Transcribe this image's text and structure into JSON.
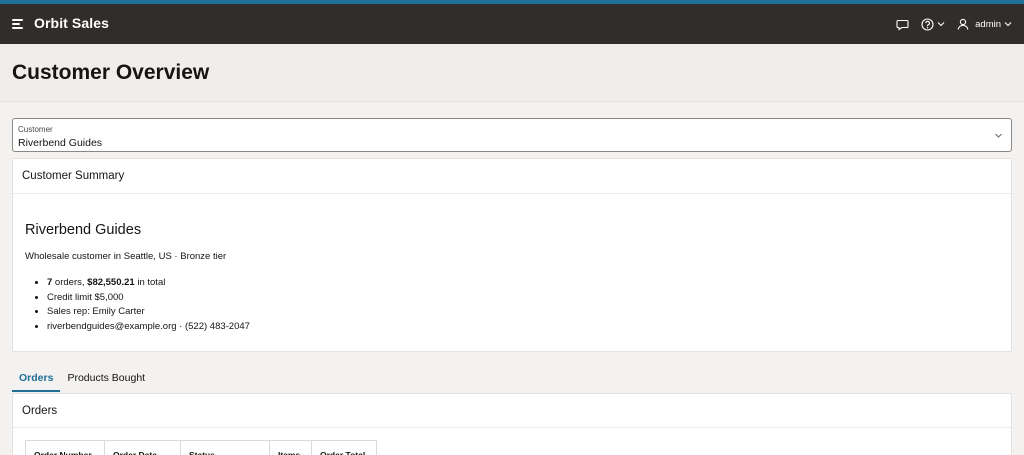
{
  "header": {
    "app_title": "Orbit Sales",
    "user_name": "admin"
  },
  "page": {
    "title": "Customer Overview"
  },
  "customer_select": {
    "label": "Customer",
    "value": "Riverbend Guides"
  },
  "summary": {
    "heading": "Customer Summary",
    "name": "Riverbend Guides",
    "description": "Wholesale customer in Seattle, US · Bronze tier",
    "orders_count": "7",
    "orders_text": " orders, ",
    "orders_total": "$82,550.21",
    "total_suffix": " in total",
    "credit_limit": "Credit limit $5,000",
    "sales_rep": "Sales rep: Emily Carter",
    "contact": "riverbendguides@example.org · (522) 483-2047"
  },
  "tabs": [
    {
      "label": "Orders",
      "active": true
    },
    {
      "label": "Products Bought",
      "active": false
    }
  ],
  "orders": {
    "heading": "Orders",
    "columns": [
      "Order Number",
      "Order Date",
      "Status",
      "Items",
      "Order Total"
    ]
  },
  "colors": {
    "accent": "#1f6f97",
    "topbar": "#312d2a"
  }
}
